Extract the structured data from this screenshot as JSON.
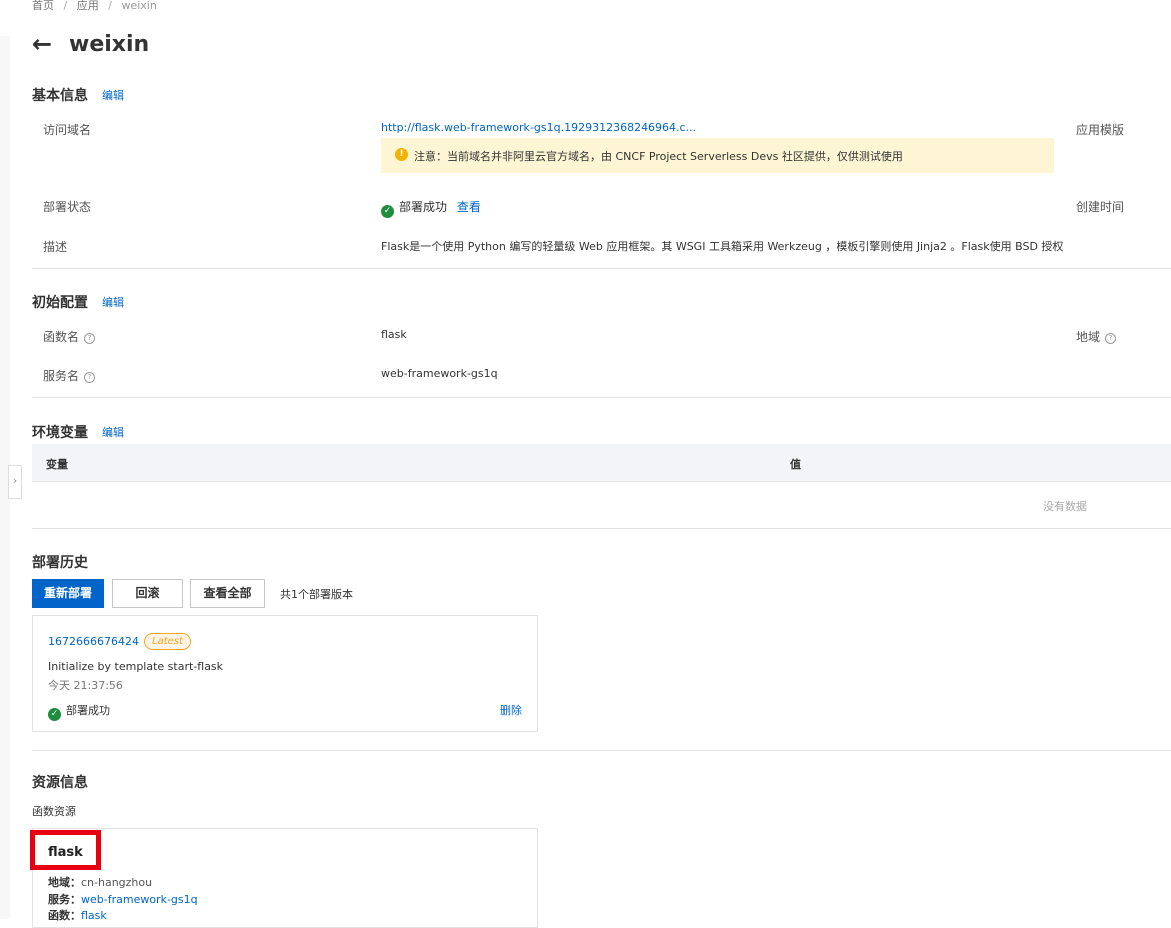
{
  "breadcrumb": {
    "items": [
      "首页",
      "应用",
      "weixin"
    ],
    "separator": "/"
  },
  "header": {
    "back_icon": "←",
    "title": "weixin"
  },
  "basic_info": {
    "title": "基本信息",
    "edit": "编辑",
    "domain_label": "访问域名",
    "domain_value": "http://flask.web-framework-gs1q.1929312368246964.c...",
    "notice_text": "注意：当前域名并非阿里云官方域名，由 CNCF Project Serverless Devs 社区提供，仅供测试使用",
    "template_label": "应用模版",
    "deploy_status_label": "部署状态",
    "deploy_status_value": "部署成功",
    "view_link": "查看",
    "created_label": "创建时间",
    "desc_label": "描述",
    "desc_value": "Flask是一个使用 Python 编写的轻量级 Web 应用框架。其 WSGI 工具箱采用 Werkzeug ，模板引擎则使用 Jinja2 。Flask使用 BSD 授权"
  },
  "initial_config": {
    "title": "初始配置",
    "edit": "编辑",
    "func_label": "函数名",
    "func_value": "flask",
    "region_label": "地域",
    "service_label": "服务名",
    "service_value": "web-framework-gs1q"
  },
  "env": {
    "title": "环境变量",
    "edit": "编辑",
    "col_var": "变量",
    "col_val": "值",
    "empty": "没有数据"
  },
  "deploy_history": {
    "title": "部署历史",
    "redeploy": "重新部署",
    "rollback": "回滚",
    "view_all": "查看全部",
    "count_text": "共1个部署版本",
    "item": {
      "id": "1672666676424",
      "badge": "Latest",
      "message": "Initialize by template start-flask",
      "time": "今天 21:37:56",
      "status": "部署成功",
      "delete": "删除"
    }
  },
  "resources": {
    "title": "资源信息",
    "subtitle": "函数资源",
    "card": {
      "name": "flask",
      "region_label": "地域：",
      "region_value": "cn-hangzhou",
      "service_label": "服务：",
      "service_value": "web-framework-gs1q",
      "func_label": "函数：",
      "func_value": "flask"
    }
  },
  "colors": {
    "accent": "#0064c8",
    "success": "#1e8e3e",
    "notice_bg": "#fdf5d3",
    "highlight": "#e60012"
  },
  "icons": [
    "back-arrow-icon",
    "help-icon",
    "warning-icon",
    "check-circle-icon",
    "sidebar-toggle-icon"
  ]
}
